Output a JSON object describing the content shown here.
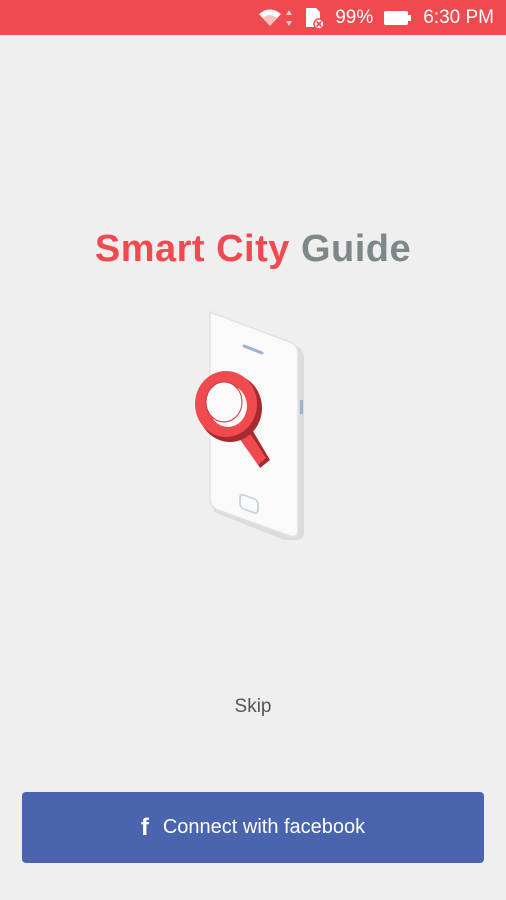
{
  "status_bar": {
    "battery_percent": "99%",
    "time": "6:30 PM",
    "icons": [
      "wifi-icon",
      "data-arrows-icon",
      "sd-card-error-icon",
      "battery-icon"
    ],
    "background_color": "#ef4a4f"
  },
  "app": {
    "title_part1": "Smart City",
    "title_part2": "Guide",
    "brand_color": "#ef4a4f",
    "secondary_color": "#7f8888",
    "illustration_icon": "phone-magnifier-illustration"
  },
  "actions": {
    "skip_label": "Skip",
    "facebook_label": "Connect with facebook",
    "facebook_icon": "facebook-icon",
    "facebook_color": "#4a64ad"
  }
}
